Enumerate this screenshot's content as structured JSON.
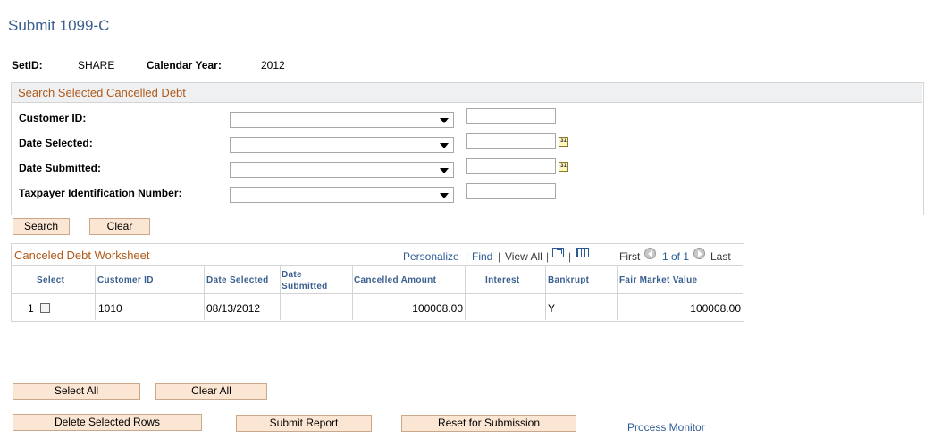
{
  "page": {
    "title": "Submit 1099-C"
  },
  "info": {
    "setid_label": "SetID:",
    "setid_value": "SHARE",
    "year_label": "Calendar Year:",
    "year_value": "2012"
  },
  "search": {
    "title": "Search Selected Cancelled Debt",
    "fields": [
      {
        "label": "Customer ID:",
        "operator": "",
        "value": ""
      },
      {
        "label": "Date Selected:",
        "operator": "",
        "value": ""
      },
      {
        "label": "Date Submitted:",
        "operator": "",
        "value": ""
      },
      {
        "label": "Taxpayer Identification Number:",
        "operator": "",
        "value": ""
      }
    ],
    "calendar_icon_text": "31",
    "search_label": "Search",
    "clear_label": "Clear"
  },
  "grid": {
    "title": "Canceled Debt Worksheet",
    "personalize": "Personalize",
    "find": "Find",
    "view_all": "View All",
    "first": "First",
    "pagination": "1 of 1",
    "last": "Last",
    "columns": {
      "select": "Select",
      "customer_id": "Customer ID",
      "date_selected": "Date Selected",
      "date_submitted": "Date Submitted",
      "cancelled_amount": "Cancelled Amount",
      "interest": "Interest",
      "bankrupt": "Bankrupt",
      "fair_market_value": "Fair Market Value"
    },
    "rows": [
      {
        "num": "1",
        "customer_id": "1010",
        "date_selected": "08/13/2012",
        "date_submitted": "",
        "cancelled_amount": "100008.00",
        "interest": "",
        "bankrupt": "Y",
        "fair_market_value": "100008.00"
      }
    ]
  },
  "actions": {
    "select_all": "Select All",
    "clear_all": "Clear All",
    "delete_selected": "Delete Selected Rows",
    "submit_report": "Submit Report",
    "reset_submission": "Reset for Submission",
    "process_monitor": "Process Monitor"
  },
  "colors": {
    "title_blue": "#3a5f8f",
    "section_orange": "#b05a1a",
    "button_bg": "#fbe6d3",
    "link_blue": "#2a5a95"
  }
}
